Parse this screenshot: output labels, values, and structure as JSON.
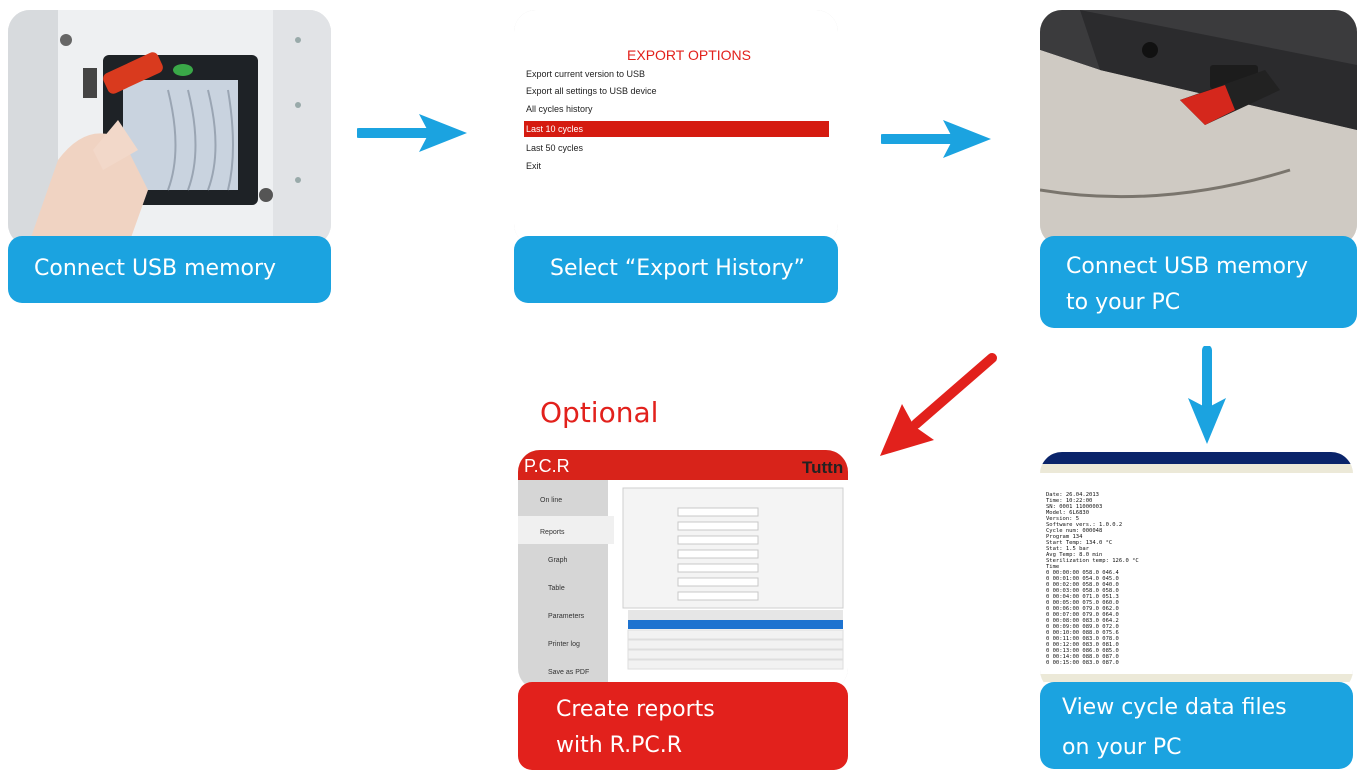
{
  "steps": [
    {
      "caption": [
        "Connect USB memory"
      ]
    },
    {
      "caption": [
        "Select “Export History”"
      ]
    },
    {
      "caption": [
        "Connect USB memory",
        "to your PC"
      ]
    },
    {
      "caption": [
        "View cycle data files",
        "on your PC"
      ]
    },
    {
      "caption": [
        "Create reports",
        "with R.PC.R"
      ]
    }
  ],
  "optional_label": "Optional",
  "export_menu": {
    "title": "EXPORT OPTIONS",
    "items": [
      "Export current version to USB",
      "Export all settings to USB device",
      "All cycles history",
      "Last 10 cycles",
      "Last 50 cycles",
      "Exit"
    ],
    "selected_index": 3
  },
  "rpcr": {
    "logo": "P.C.R",
    "brand": "Tuttn",
    "menu": [
      "On line",
      "Reports",
      "Graph",
      "Table",
      "Parameters",
      "Printer log",
      "Save as PDF"
    ],
    "selected_menu_index": 1
  },
  "notepad": {
    "lines": [
      "Date: 26.04.2013",
      "Time: 10:22:00",
      "SN: 0001 11000003",
      "Model: 6L6830",
      "Version: 5",
      "Software vers.: 1.0.0.2",
      "Cycle num: 000048",
      "Program 134",
      "Start Temp: 134.0 °C",
      "Stat: 1.5 bar",
      "Avg Temp: 8.0 min",
      "Sterilization temp: 126.0 °C",
      "  Time",
      "0 00:00:00 058.0 046.4",
      "0 00:01:00 054.0 045.0",
      "0 00:02:00 058.0 040.0",
      "0 00:03:00 058.0 058.0",
      "0 00:04:00 071.0 051.3",
      "0 00:05:00 075.0 060.0",
      "0 00:06:00 079.0 062.0",
      "0 00:07:00 079.0 064.0",
      "0 00:08:00 083.0 064.2",
      "0 00:09:00 089.0 072.0",
      "0 00:10:00 088.0 075.6",
      "0 00:11:00 083.0 078.0",
      "0 00:12:00 083.0 081.0",
      "0 00:13:00 086.0 085.0",
      "0 00:14:00 088.0 087.0",
      "0 00:15:00 083.0 087.0"
    ]
  },
  "colors": {
    "blue": "#1ba3e0",
    "red": "#e2211c",
    "menu_highlight": "#d51b10"
  }
}
